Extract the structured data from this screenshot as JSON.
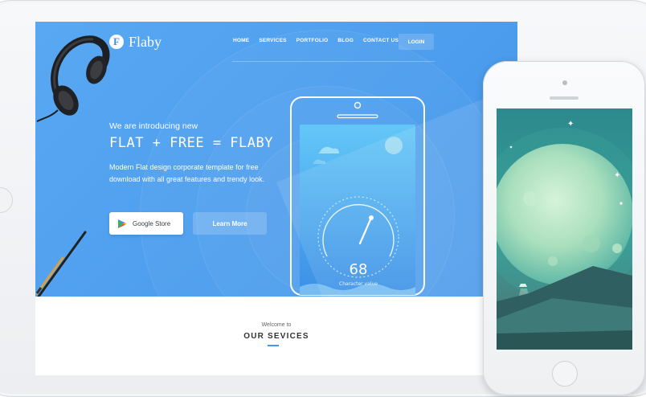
{
  "site": {
    "logo_letter": "F",
    "logo_text": "Flaby"
  },
  "nav": {
    "items": [
      "HOME",
      "SERVICES",
      "PORTFOLIO",
      "BLOG",
      "CONTACT US"
    ],
    "login": "LOGIN"
  },
  "hero": {
    "intro": "We are introducing new",
    "title": "FLAT + FREE = FLABY",
    "description": "Modern Flat design corporate template for free download with all great features and trendy look.",
    "store_button": "Google Store",
    "learn_button": "Learn More"
  },
  "phone_widget": {
    "value": "68",
    "caption": "Character value"
  },
  "services": {
    "welcome": "Welcome to",
    "title": "OUR SEVICES"
  },
  "colors": {
    "hero_blue": "#4596ea",
    "accent": "#4596ea",
    "iphone_wallpaper": "#2c8a8d"
  },
  "icons": [
    "headphones-icon",
    "pencil-icon",
    "play-store-icon",
    "planet-icon",
    "ufo-icon"
  ]
}
